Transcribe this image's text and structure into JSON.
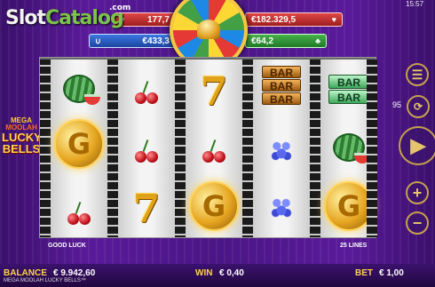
{
  "status": {
    "time": "15:57"
  },
  "watermark": {
    "part1": "Slot",
    "part2": "Catalog",
    "suffix": ".com"
  },
  "jackpots": {
    "red_left": "177,7",
    "blue": "€433,3",
    "red_right": "€182.329,5",
    "green": "€64,2"
  },
  "game_logo": {
    "line1": "MEGA",
    "line2": "MOOLAH",
    "line3": "LUCKY BELLS"
  },
  "reels": [
    [
      "watermelon",
      "gold-coin",
      "cherries"
    ],
    [
      "cherries",
      "cherries",
      "seven"
    ],
    [
      "seven",
      "cherries",
      "gold-coin"
    ],
    [
      "triple-bar",
      "grapes",
      "grapes"
    ],
    [
      "double-bar",
      "watermelon",
      "gold-coin"
    ]
  ],
  "bar_texts": {
    "triple": [
      "BAR",
      "BAR",
      "BAR"
    ],
    "double": [
      "BAR",
      "BAR"
    ]
  },
  "coin_letter": "G",
  "messages": {
    "left": "GOOD LUCK",
    "right": "25 LINES"
  },
  "controls": {
    "autoplay_count": "95"
  },
  "footer": {
    "balance_label": "BALANCE",
    "balance_value": "€ 9.942,60",
    "win_label": "WIN",
    "win_value": "€ 0,40",
    "bet_label": "BET",
    "bet_value": "€ 1,00",
    "game_name": "MEGA MOOLAH LUCKY BELLS™"
  }
}
